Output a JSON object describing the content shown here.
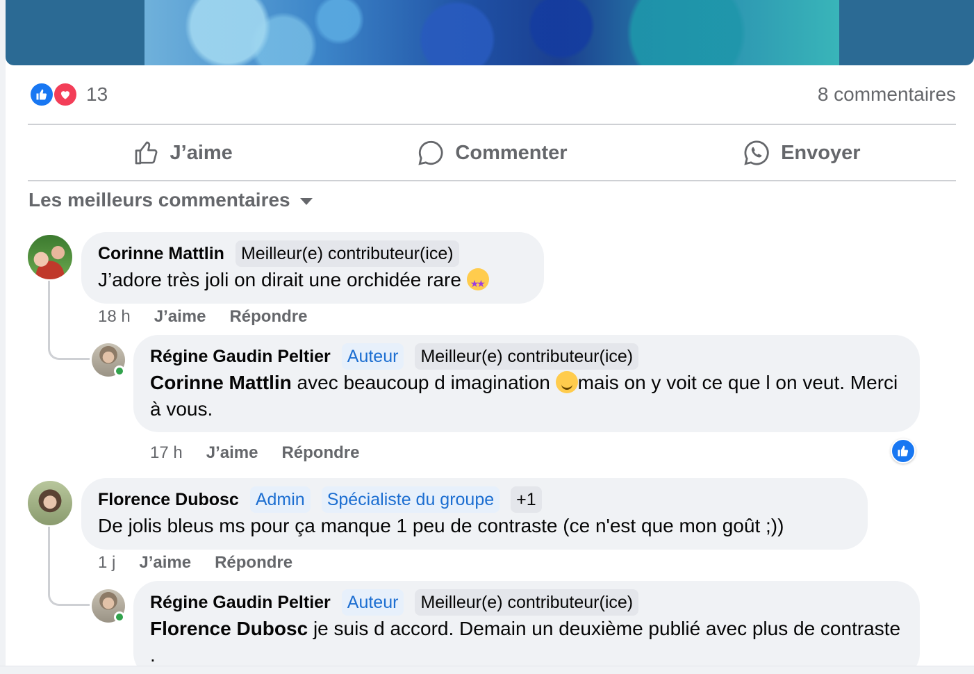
{
  "post": {
    "reaction_count": "13",
    "comment_count": "8 commentaires"
  },
  "actions": {
    "like": "J’aime",
    "comment": "Commenter",
    "send": "Envoyer"
  },
  "sort_label": "Les meilleurs commentaires",
  "comments": [
    {
      "author": "Corinne Mattlin",
      "badges": [
        "Meilleur(e) contributeur(ice)"
      ],
      "text": "J’adore très joli on dirait une orchidée rare",
      "time": "18 h",
      "like": "J’aime",
      "reply": "Répondre",
      "replies": [
        {
          "author": "Régine Gaudin Peltier",
          "badges": [
            "Auteur",
            "Meilleur(e) contributeur(ice)"
          ],
          "mention": "Corinne Mattlin",
          "text_a": " avec beaucoup d imagination ",
          "text_b": "mais on y voit ce que l on veut. Merci à vous.",
          "time": "17 h",
          "like": "J’aime",
          "reply": "Répondre"
        }
      ]
    },
    {
      "author": "Florence Dubosc",
      "badges": [
        "Admin",
        "Spécialiste du groupe",
        "+1"
      ],
      "text": "De jolis bleus ms pour ça manque 1 peu de contraste (ce n'est que mon goût ;))",
      "time": "1 j",
      "like": "J’aime",
      "reply": "Répondre",
      "replies": [
        {
          "author": "Régine Gaudin Peltier",
          "badges": [
            "Auteur",
            "Meilleur(e) contributeur(ice)"
          ],
          "mention": "Florence Dubosc",
          "text": " je suis d accord. Demain un deuxième publié avec plus de contraste ."
        }
      ]
    }
  ],
  "colors": {
    "accent": "#1877f2",
    "love": "#f33e58",
    "secondary_text": "#65676b",
    "bubble": "#f0f2f5",
    "badge_blue_text": "#1c6ed1"
  }
}
